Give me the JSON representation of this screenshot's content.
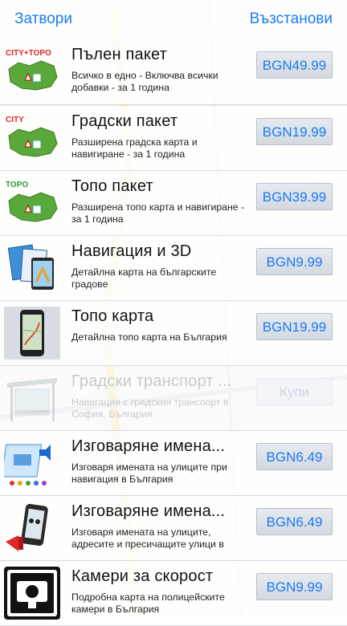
{
  "header": {
    "close_label": "Затвори",
    "restore_label": "Възстанови"
  },
  "products": [
    {
      "icon": "bulgaria-city-topo-icon",
      "badge": "CITY+TOPO",
      "title": "Пълен пакет",
      "description": "Всичко в едно - Включва всички добавки - за 1 година",
      "price": "BGN49.99",
      "enabled": true
    },
    {
      "icon": "bulgaria-city-icon",
      "badge": "CITY",
      "title": "Градски пакет",
      "description": "Разширена градска карта и навигиране - за 1 година",
      "price": "BGN19.99",
      "enabled": true
    },
    {
      "icon": "bulgaria-topo-icon",
      "badge": "TOPO",
      "title": "Топо пакет",
      "description": "Разширена топо карта и навигиране - за 1 година",
      "price": "BGN39.99",
      "enabled": true
    },
    {
      "icon": "navigation-3d-icon",
      "badge": "",
      "title": "Навигация и 3D",
      "description": "Детайлна карта на българските градове",
      "price": "BGN9.99",
      "enabled": true
    },
    {
      "icon": "phone-topo-map-icon",
      "badge": "",
      "title": "Топо карта",
      "description": "Детайлна топо карта на България",
      "price": "BGN19.99",
      "enabled": true
    },
    {
      "icon": "bus-stop-icon",
      "badge": "",
      "title": "Градски транспорт ...",
      "description": "Навигация с градския транспорт в София, България",
      "price": "Купи",
      "enabled": false
    },
    {
      "icon": "street-names-voice-icon",
      "badge": "",
      "title": "Изговаряне имена...",
      "description": "Изговаря имената на улиците при навигация в България",
      "price": "BGN6.49",
      "enabled": true
    },
    {
      "icon": "phone-megaphone-icon",
      "badge": "",
      "title": "Изговаряне имена...",
      "description": "Изговаря имената на улиците, адресите и пресичащите улици в",
      "price": "BGN6.49",
      "enabled": true
    },
    {
      "icon": "speed-camera-icon",
      "badge": "",
      "title": "Камери за скорост",
      "description": "Подробна карта на полицейските камери в България",
      "price": "BGN9.99",
      "enabled": true
    }
  ],
  "colors": {
    "accent": "#1a7cf5",
    "bulgaria_green": "#4c9a2a",
    "city_red": "#e0262a",
    "topo_green": "#2e9b3a"
  }
}
